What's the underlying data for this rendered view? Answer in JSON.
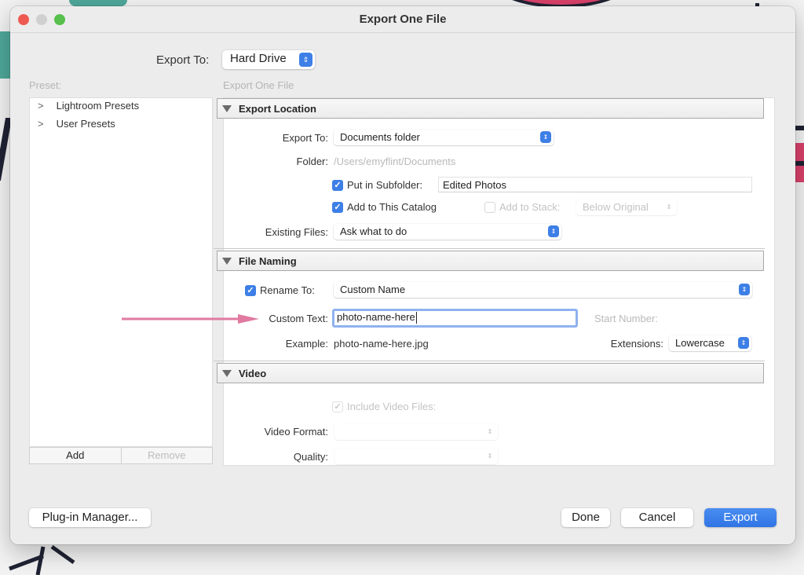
{
  "window": {
    "title": "Export One File"
  },
  "header": {
    "export_to_label": "Export To:",
    "export_to_value": "Hard Drive"
  },
  "presets": {
    "label": "Preset:",
    "items": [
      {
        "label": "Lightroom Presets"
      },
      {
        "label": "User Presets"
      }
    ],
    "add_label": "Add",
    "remove_label": "Remove"
  },
  "panel": {
    "label": "Export One File",
    "export_location": {
      "title": "Export Location",
      "export_to_label": "Export To:",
      "export_to_value": "Documents folder",
      "folder_label": "Folder:",
      "folder_value": "/Users/emyflint/Documents",
      "subfolder_label": "Put in Subfolder:",
      "subfolder_checked": true,
      "subfolder_value": "Edited Photos",
      "add_catalog_label": "Add to This Catalog",
      "add_catalog_checked": true,
      "add_stack_label": "Add to Stack:",
      "add_stack_checked": false,
      "stack_value": "Below Original",
      "existing_label": "Existing Files:",
      "existing_value": "Ask what to do"
    },
    "file_naming": {
      "title": "File Naming",
      "rename_label": "Rename To:",
      "rename_checked": true,
      "rename_value": "Custom Name",
      "custom_text_label": "Custom Text:",
      "custom_text_value": "photo-name-here",
      "start_number_label": "Start Number:",
      "example_label": "Example:",
      "example_value": "photo-name-here.jpg",
      "extensions_label": "Extensions:",
      "extensions_value": "Lowercase"
    },
    "video": {
      "title": "Video",
      "include_label": "Include Video Files:",
      "include_checked": true,
      "format_label": "Video Format:",
      "format_value": "",
      "quality_label": "Quality:",
      "quality_value": ""
    }
  },
  "footer": {
    "plugin_manager_label": "Plug-in Manager...",
    "done_label": "Done",
    "cancel_label": "Cancel",
    "export_label": "Export"
  },
  "icons": {
    "stepper": "⇕",
    "check": "✓",
    "chevron": ">"
  },
  "colors": {
    "accent": "#3d7fe6",
    "annotation_arrow": "#e07aa0"
  }
}
